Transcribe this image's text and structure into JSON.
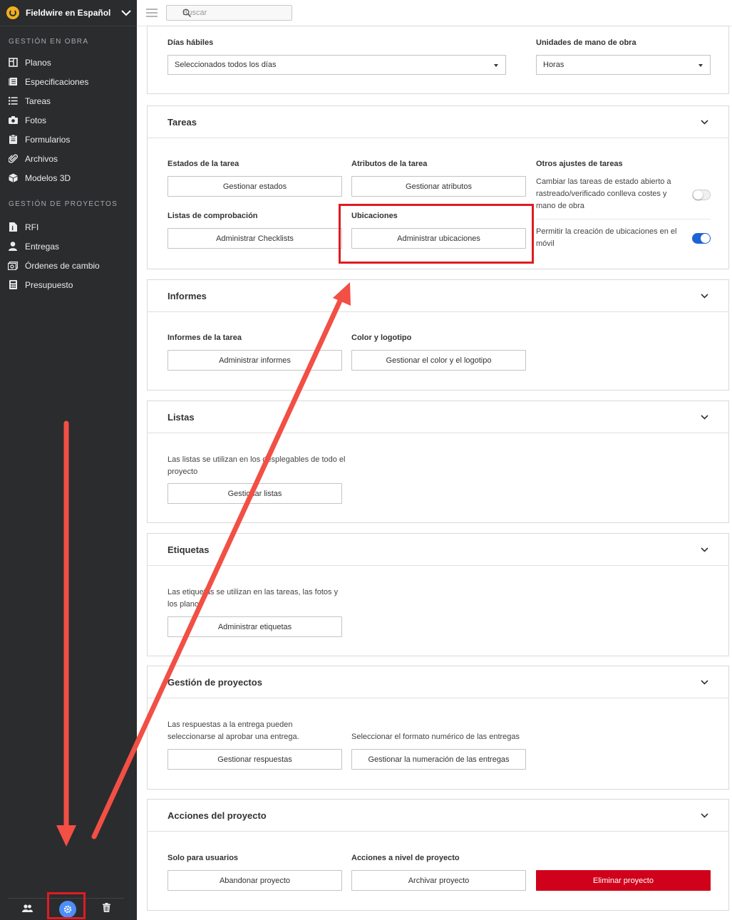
{
  "sidebar": {
    "project_name": "Fieldwire en Español",
    "section_obra": "GESTIÓN EN OBRA",
    "obra_items": [
      {
        "label": "Planos",
        "icon": "plans-icon"
      },
      {
        "label": "Especificaciones",
        "icon": "specs-icon"
      },
      {
        "label": "Tareas",
        "icon": "tasks-icon"
      },
      {
        "label": "Fotos",
        "icon": "camera-icon"
      },
      {
        "label": "Formularios",
        "icon": "clipboard-icon"
      },
      {
        "label": "Archivos",
        "icon": "paperclip-icon"
      },
      {
        "label": "Modelos 3D",
        "icon": "cube-icon"
      }
    ],
    "section_proyectos": "GESTIÓN DE PROYECTOS",
    "proyectos_items": [
      {
        "label": "RFI",
        "icon": "rfi-icon"
      },
      {
        "label": "Entregas",
        "icon": "user-icon"
      },
      {
        "label": "Órdenes de cambio",
        "icon": "change-order-icon"
      },
      {
        "label": "Presupuesto",
        "icon": "calculator-icon"
      }
    ],
    "bottom_icons": [
      "people-icon",
      "gear-icon",
      "trash-icon"
    ]
  },
  "topbar": {
    "search_placeholder": "Buscar"
  },
  "general": {
    "dias_label": "Días hábiles",
    "dias_value": "Seleccionados todos los días",
    "unidades_label": "Unidades de mano de obra",
    "unidades_value": "Horas"
  },
  "tareas": {
    "title": "Tareas",
    "estados_label": "Estados de la tarea",
    "estados_btn": "Gestionar estados",
    "atributos_label": "Atributos de la tarea",
    "atributos_btn": "Gestionar atributos",
    "otros_label": "Otros ajustes de tareas",
    "setting1": "Cambiar las tareas de estado abierto a rastreado/verificado conlleva costes y mano de obra",
    "setting1_on": false,
    "setting2": "Permitir la creación de ubicaciones en el móvil",
    "setting2_on": true,
    "checklists_label": "Listas de comprobación",
    "checklists_btn": "Administrar Checklists",
    "ubicaciones_label": "Ubicaciones",
    "ubicaciones_btn": "Administrar ubicaciones"
  },
  "informes": {
    "title": "Informes",
    "tarea_label": "Informes de la tarea",
    "tarea_btn": "Administrar informes",
    "color_label": "Color y logotipo",
    "color_btn": "Gestionar el color y el logotipo"
  },
  "listas": {
    "title": "Listas",
    "desc": "Las listas se utilizan en los desplegables de todo el proyecto",
    "btn": "Gestionar listas"
  },
  "etiquetas": {
    "title": "Etiquetas",
    "desc": "Las etiquetas se utilizan en las tareas, las fotos y los planos",
    "btn": "Administrar etiquetas"
  },
  "gestion": {
    "title": "Gestión de proyectos",
    "desc1": "Las respuestas a la entrega pueden seleccionarse al aprobar una entrega.",
    "btn1": "Gestionar respuestas",
    "desc2": "Seleccionar el formato numérico de las entregas",
    "btn2": "Gestionar la numeración de las entregas"
  },
  "acciones": {
    "title": "Acciones del proyecto",
    "usuarios_label": "Solo para usuarios",
    "abandonar_btn": "Abandonar proyecto",
    "nivel_label": "Acciones a nivel de proyecto",
    "archivar_btn": "Archivar proyecto",
    "eliminar_btn": "Eliminar proyecto"
  },
  "colors": {
    "sidebar_bg": "#2b2c2e",
    "accent_blue": "#1e63d6",
    "danger_red": "#d0021b",
    "annotation_red": "#f24f45"
  }
}
